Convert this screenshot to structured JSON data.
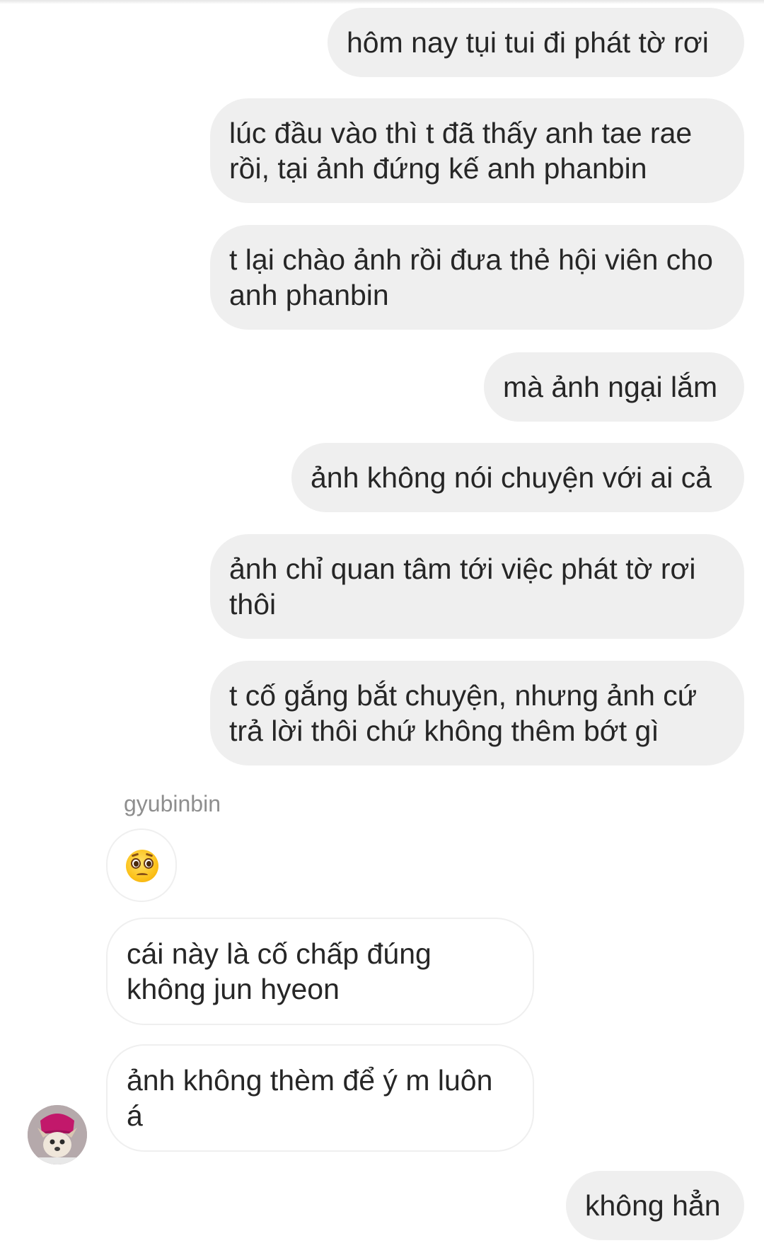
{
  "conversation": {
    "messages": [
      {
        "direction": "out",
        "text": "hôm nay tụi tui đi phát tờ rơi"
      },
      {
        "direction": "out",
        "text": "lúc đầu vào thì t đã thấy anh tae rae rồi, tại ảnh đứng kế anh phanbin"
      },
      {
        "direction": "out",
        "text": "t lại chào ảnh rồi đưa thẻ hội viên cho anh phanbin"
      },
      {
        "direction": "out",
        "text": "mà ảnh ngại lắm"
      },
      {
        "direction": "out",
        "text": "ảnh không nói chuyện với ai cả"
      },
      {
        "direction": "out",
        "text": "ảnh chỉ quan tâm tới việc phát tờ rơi thôi"
      },
      {
        "direction": "out",
        "text": "t cố gắng bắt chuyện, nhưng ảnh cứ trả lời thôi chứ không thêm bớt gì"
      },
      {
        "direction": "in",
        "text": "cái này là cố chấp đúng không jun hyeon"
      },
      {
        "direction": "in",
        "text": "ảnh không thèm để ý m luôn á"
      },
      {
        "direction": "out",
        "text": "không hẳn"
      }
    ],
    "sender_name": "gyubinbin",
    "reaction_emoji": "pleading-face-icon",
    "colors": {
      "outgoing_bubble": "#efefef",
      "incoming_border": "#efefef",
      "text": "#262626",
      "sender_name": "#8e8e8e"
    }
  }
}
